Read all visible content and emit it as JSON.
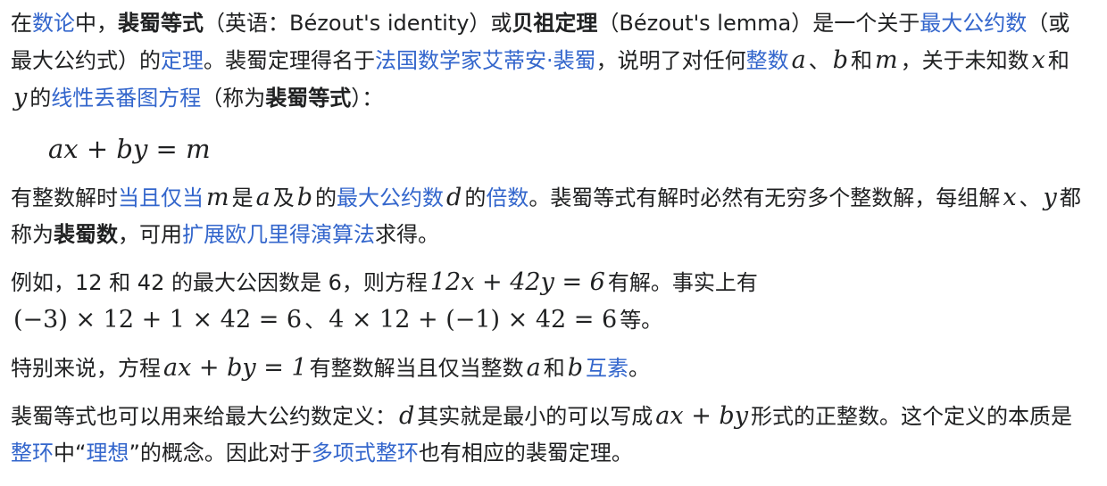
{
  "p1": {
    "t1": "在",
    "link_number_theory": "数论",
    "t2": "中，",
    "b_bezout_identity": "裴蜀等式",
    "t3": "（英语：Bézout's identity）或",
    "b_bezout_lemma": "贝祖定理",
    "t4": "（Bézout's lemma）是一个关于",
    "link_gcd": "最大公约数",
    "t5": "（或最大公约式）的",
    "link_theorem": "定理",
    "t6": "。裴蜀定理得名于",
    "link_bezout_person": "法国数学家艾蒂安·裴蜀",
    "t7": "，说明了对任何",
    "link_integer": "整数",
    "m_a": "a",
    "t8": "、",
    "m_b": "b",
    "t9": "和",
    "m_m": "m",
    "t10": "，关于未知数",
    "m_x": "x",
    "t11": "和",
    "m_y": "y",
    "t12": "的",
    "link_diophantine": "线性丢番图方程",
    "t13": "（称为",
    "b_bezout_identity_2": "裴蜀等式",
    "t14": "）："
  },
  "equation": "ax + by = m",
  "p3": {
    "t1": "有整数解时",
    "link_iff": "当且仅当",
    "m_m": "m",
    "t2": "是",
    "m_a": "a",
    "t3": "及",
    "m_b": "b",
    "t4": "的",
    "link_gcd": "最大公约数",
    "m_d": "d",
    "t5": "的",
    "link_multiple": "倍数",
    "t6": "。裴蜀等式有解时必然有无穷多个整数解，每组解",
    "m_x": "x",
    "t7": "、",
    "m_y": "y",
    "t8": "都称为",
    "b_bezout_numbers": "裴蜀数",
    "t9": "，可用",
    "link_ext_euclid": "扩展欧几里得演算法",
    "t10": "求得。"
  },
  "p4": {
    "t1": "例如，12 和 42 的最大公因数是 6，则方程",
    "m_eq": "12x + 42y = 6",
    "t2": "有解。事实上有",
    "m_ex1": "(−3) × 12 + 1 × 42 = 6",
    "t3": "、",
    "m_ex2": "4 × 12 + (−1) × 42 = 6",
    "t4": "等。"
  },
  "p5": {
    "t1": "特别来说，方程",
    "m_eq": "ax + by = 1",
    "t2": "有整数解当且仅当整数",
    "m_a": "a",
    "t3": "和",
    "m_b": "b",
    "link_coprime": "互素",
    "t4": "。"
  },
  "p6": {
    "t1": "裴蜀等式也可以用来给最大公约数定义：",
    "m_d": "d",
    "t2": "其实就是最小的可以写成",
    "m_expr": "ax + by",
    "t3": "形式的正整数。这个定义的本质是",
    "link_ring": "整环",
    "t4": "中“",
    "link_ideal": "理想",
    "t5": "”的概念。因此对于",
    "link_poly_ring": "多项式整环",
    "t6": "也有相应的裴蜀定理。"
  },
  "colors": {
    "text": "#202122",
    "link": "#3366cc",
    "background": "#ffffff"
  }
}
